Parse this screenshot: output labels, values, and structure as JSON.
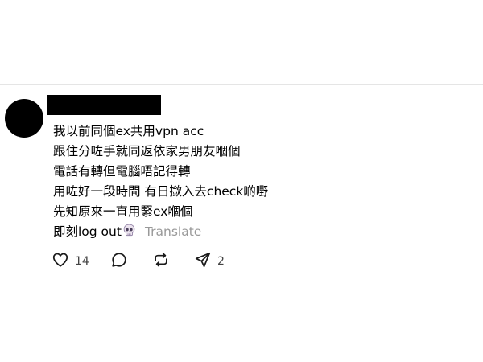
{
  "post": {
    "text_lines": [
      "我以前同個ex共用vpn acc",
      "跟住分咗手就同返依家男朋友嗰個",
      "電話有轉但電腦唔記得轉",
      "用咗好一段時間 有日撳入去check啲嘢",
      "先知原來一直用緊ex嗰個",
      "即刻log out"
    ],
    "emoji_icon": "skull-icon",
    "translate_label": "Translate",
    "actions": {
      "like_count": "14",
      "share_count": "2"
    }
  },
  "colors": {
    "text": "#000000",
    "secondary": "#999999",
    "divider": "#e5e5e5",
    "redaction": "#000000"
  }
}
